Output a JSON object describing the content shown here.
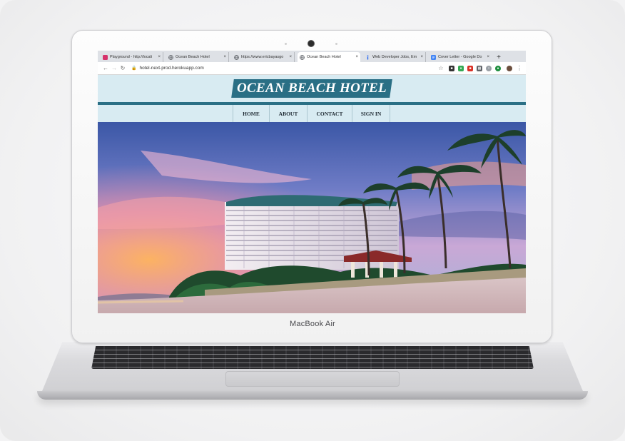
{
  "device": {
    "brand_label": "MacBook Air"
  },
  "browser": {
    "tabs": [
      {
        "label": "Playground - http://locali",
        "icon": "playground-icon",
        "color": "#d6336c",
        "active": false
      },
      {
        "label": "Ocean Beach Hotel",
        "icon": "globe-icon",
        "color": "#5f6368",
        "active": false
      },
      {
        "label": "https://www.ericbayasgo",
        "icon": "globe-icon",
        "color": "#5f6368",
        "active": false
      },
      {
        "label": "Ocean Beach Hotel",
        "icon": "globe-icon",
        "color": "#5f6368",
        "active": true
      },
      {
        "label": "Web Developer Jobs, Em",
        "icon": "indeed-icon",
        "color": "#2164f3",
        "active": false
      },
      {
        "label": "Cover Letter - Google Do",
        "icon": "docs-icon",
        "color": "#4285f4",
        "active": false
      }
    ],
    "tab_close_glyph": "×",
    "new_tab_glyph": "+",
    "address": "hotel-next-prod.herokuapp.com",
    "extensions": [
      {
        "name": "grammar-extension-icon",
        "color": "#333333"
      },
      {
        "name": "puzzle-extension-icon",
        "color": "#34a853"
      },
      {
        "name": "red-extension-icon",
        "color": "#d93025"
      },
      {
        "name": "calendar-extension-icon",
        "color": "#5f6368"
      },
      {
        "name": "circle-extension-icon",
        "color": "#9aa0a6"
      },
      {
        "name": "green-extension-icon",
        "color": "#1e8e3e"
      }
    ]
  },
  "site": {
    "logo_text": "OCEAN BEACH HOTEL",
    "nav": [
      {
        "label": "HOME"
      },
      {
        "label": "ABOUT"
      },
      {
        "label": "CONTACT"
      },
      {
        "label": "SIGN IN"
      }
    ],
    "colors": {
      "brand": "#2a6f85",
      "header_bg": "#d8ebf2"
    },
    "hero": {
      "image": "beachfront-hotel-sunset-photo"
    }
  }
}
